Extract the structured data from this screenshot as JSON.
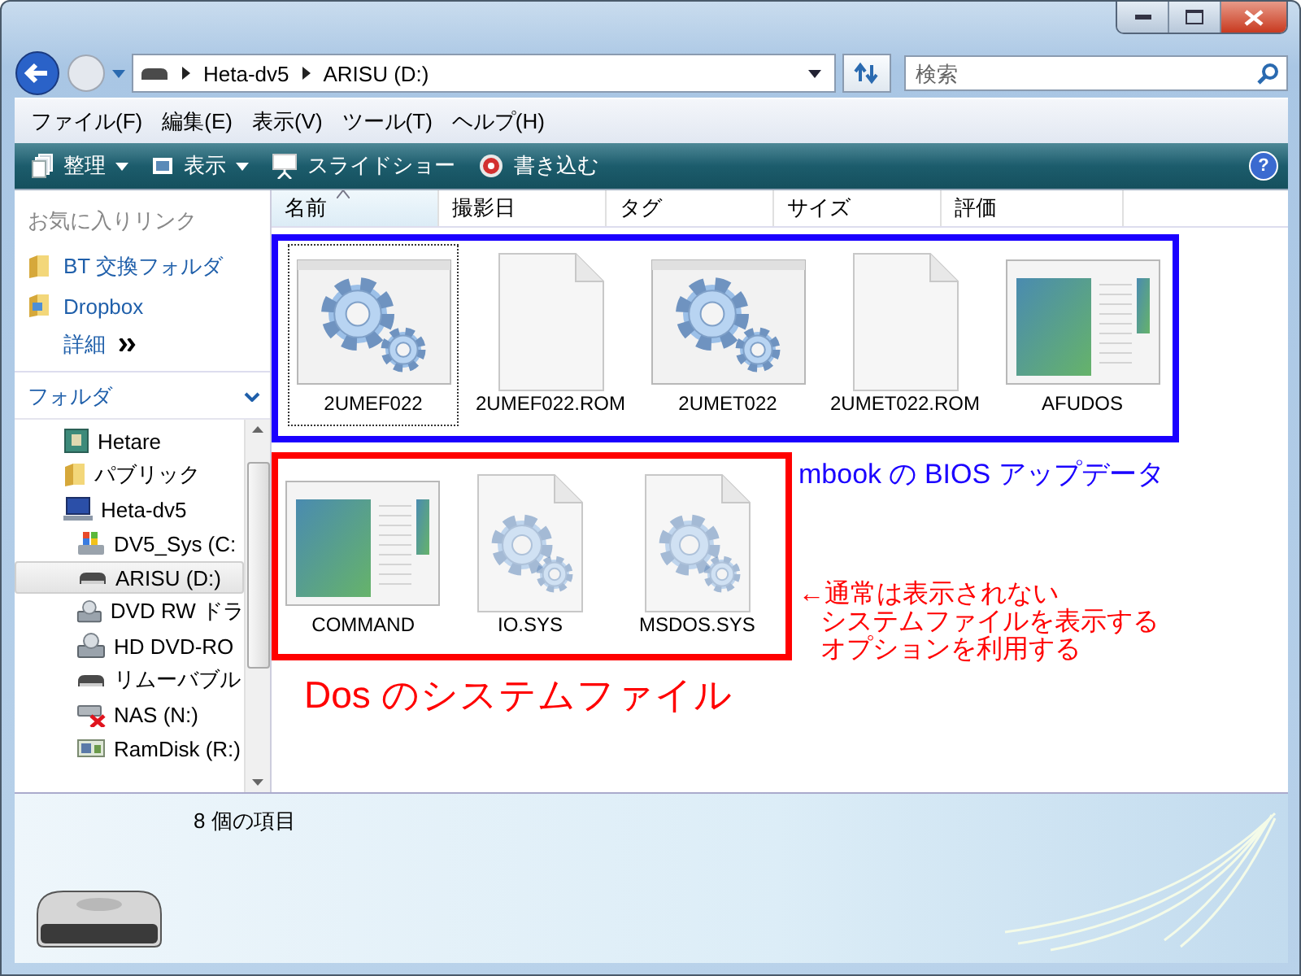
{
  "address": {
    "parts": [
      "Heta-dv5",
      "ARISU (D:)"
    ]
  },
  "search": {
    "placeholder": "検索"
  },
  "menu": [
    "ファイル(F)",
    "編集(E)",
    "表示(V)",
    "ツール(T)",
    "ヘルプ(H)"
  ],
  "toolbar": [
    {
      "label": "整理",
      "kind": "organize",
      "dropdown": true
    },
    {
      "label": "表示",
      "kind": "views",
      "dropdown": true
    },
    {
      "label": "スライドショー",
      "kind": "slideshow",
      "dropdown": false
    },
    {
      "label": "書き込む",
      "kind": "burn",
      "dropdown": false
    }
  ],
  "favorites": {
    "title": "お気に入りリンク",
    "items": [
      {
        "label": "BT 交換フォルダ",
        "kind": "folder"
      },
      {
        "label": "Dropbox",
        "kind": "dropbox"
      }
    ],
    "more": "詳細"
  },
  "folders": {
    "title": "フォルダ",
    "items": [
      {
        "label": "Hetare",
        "kind": "user",
        "selected": false
      },
      {
        "label": "パブリック",
        "kind": "folder",
        "selected": false
      },
      {
        "label": "Heta-dv5",
        "kind": "computer",
        "selected": false,
        "children": [
          {
            "label": "DV5_Sys (C:",
            "kind": "sysdrive",
            "selected": false
          },
          {
            "label": "ARISU (D:)",
            "kind": "drive",
            "selected": true
          },
          {
            "label": "DVD RW ドラ",
            "kind": "optical",
            "selected": false
          },
          {
            "label": "HD DVD-RO",
            "kind": "optical",
            "selected": false
          },
          {
            "label": "リムーバブル",
            "kind": "drive",
            "selected": false
          },
          {
            "label": "NAS (N:)",
            "kind": "netdrive",
            "selected": false
          },
          {
            "label": "RamDisk (R:)",
            "kind": "ramdisk",
            "selected": false
          }
        ]
      }
    ]
  },
  "columns": [
    {
      "label": "名前",
      "sorted": true
    },
    {
      "label": "撮影日",
      "sorted": false
    },
    {
      "label": "タグ",
      "sorted": false
    },
    {
      "label": "サイズ",
      "sorted": false
    },
    {
      "label": "評価",
      "sorted": false
    }
  ],
  "groups": [
    {
      "color": "#1a00ff",
      "caption": "mbook の BIOS アップデータ",
      "files": [
        {
          "name": "2UMEF022",
          "kind": "program",
          "focused": true
        },
        {
          "name": "2UMEF022.ROM",
          "kind": "blank",
          "focused": false
        },
        {
          "name": "2UMET022",
          "kind": "program",
          "focused": false
        },
        {
          "name": "2UMET022.ROM",
          "kind": "blank",
          "focused": false
        },
        {
          "name": "AFUDOS",
          "kind": "app",
          "focused": false
        }
      ]
    },
    {
      "color": "#ff0000",
      "caption": "Dos のシステムファイル",
      "note": [
        "←通常は表示されない",
        "システムファイルを表示する",
        "オプションを利用する"
      ],
      "files": [
        {
          "name": "COMMAND",
          "kind": "app",
          "focused": false
        },
        {
          "name": "IO.SYS",
          "kind": "system",
          "focused": false
        },
        {
          "name": "MSDOS.SYS",
          "kind": "system",
          "focused": false
        }
      ]
    }
  ],
  "help": "?",
  "status": "8 個の項目"
}
